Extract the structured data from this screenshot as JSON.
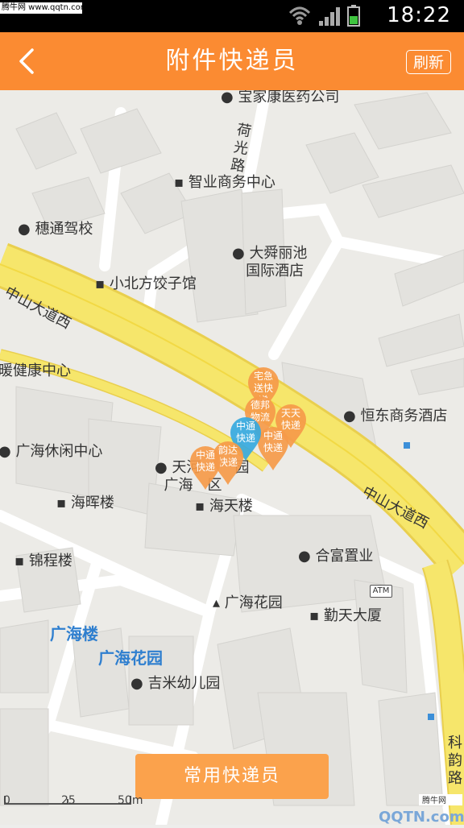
{
  "status_bar": {
    "watermark": "腾牛网 www.qqtn.com",
    "time": "18:22"
  },
  "header": {
    "title": "附件快递员",
    "refresh_label": "刷新"
  },
  "map": {
    "roads": {
      "zhongshan_west": "中山大道西",
      "zhongshan_east": "中山大道西",
      "heguang": "荷光路",
      "kejun": "科韵路"
    },
    "pois": {
      "baojiakang": "宝家康医药公司",
      "zhiye": "智业商务中心",
      "suitong": "穗通驾校",
      "dashun_1": "大舜丽池",
      "dashun_2": "国际酒店",
      "xiaobeifang": "小北方饺子馆",
      "jiankang": "暖健康中心",
      "hengdong": "恒东商务酒店",
      "guanghai_leisure": "广海休闲中心",
      "tianhe_1": "天河",
      "tianhe_2": "园",
      "guanghai_east": "广海",
      "guanghai_east2": "区",
      "haihui": "海晖楼",
      "haitian": "海天楼",
      "jincheng": "锦程楼",
      "hefu": "合富置业",
      "atm": "ATM",
      "guanghai_garden_small": "广海花园",
      "qintian": "勤天大厦",
      "guanghai_lou": "广海楼",
      "guanghai_garden_big": "广海花园",
      "jimi": "吉米幼儿园"
    },
    "markers": [
      {
        "text": "宅急送快递",
        "color": "#f59a4a"
      },
      {
        "text": "德邦物流",
        "color": "#f59a4a"
      },
      {
        "text": "天天快递",
        "color": "#f59a4a"
      },
      {
        "text": "中通快递",
        "color": "#f59a4a"
      },
      {
        "text": "中通快递",
        "color": "#36a9df"
      },
      {
        "text": "韵达快递",
        "color": "#f59a4a"
      },
      {
        "text": "中通快递",
        "color": "#f59a4a"
      }
    ],
    "scale": {
      "zero": "0",
      "mid": "25",
      "end": "50m"
    }
  },
  "bottom": {
    "button_label": "常用快递员"
  },
  "watermark_br": {
    "line1": "腾牛网",
    "line2": "QQTN.com"
  }
}
